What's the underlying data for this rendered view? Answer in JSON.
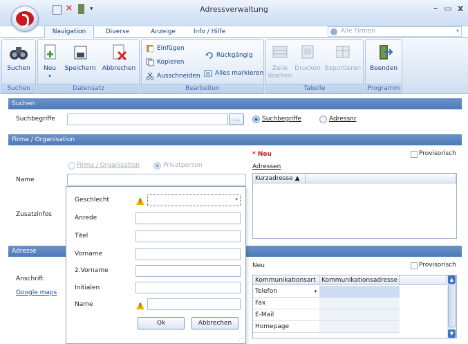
{
  "window": {
    "title": "Adressverwaltung"
  },
  "tabs": [
    "Navigation",
    "Diverse",
    "Anzeige",
    "Info / Hilfe"
  ],
  "company_placeholder": "Alle Firmen",
  "ribbon": {
    "suchen": {
      "button": "Suchen",
      "group": "Suchen"
    },
    "datensatz": {
      "neu": "Neu",
      "speichern": "Speichern",
      "abbrechen": "Abbrechen",
      "group": "Datensatz"
    },
    "bearbeiten": {
      "einfuegen": "Einfügen",
      "kopieren": "Kopieren",
      "ausschneiden": "Ausschneiden",
      "rueckgaengig": "Rückgängig",
      "alles_markieren": "Alles markieren",
      "group": "Bearbeiten"
    },
    "tabelle": {
      "zeile": "Zeile",
      "loeschen": "löschen",
      "drucken": "Drucken",
      "exportieren": "Exportieren",
      "group": "Tabelle"
    },
    "programm": {
      "beenden": "Beenden",
      "group": "Programm"
    }
  },
  "suchen": {
    "header": "Suchen",
    "label": "Suchbegriffe",
    "browse": "....",
    "radio_suchbegriffe": "Suchbegriffe",
    "radio_adressnr": "Adressnr"
  },
  "firma": {
    "header": "Firma / Organisation",
    "radio_firma": "Firma / Organisation",
    "radio_privat": "Privatperson",
    "name_label": "Name",
    "zusatz_label": "Zusatzinfos",
    "neu": "* Neu",
    "adressen": "Adressen",
    "provisorisch": "Provisorisch",
    "grid_col": "Kurzadresse ▲"
  },
  "popup": {
    "geschlecht": "Geschlecht",
    "anrede": "Anrede",
    "titel": "Titel",
    "vorname": "Vorname",
    "vorname2": "2.Vorname",
    "initialen": "Initialen",
    "name": "Name",
    "ok": "Ok",
    "abbrechen": "Abbrechen"
  },
  "adresse": {
    "header": "Adresse",
    "anschrift": "Anschrift",
    "google": "Google maps",
    "neu": "Neu",
    "provisorisch": "Provisorisch",
    "col1": "Kommunikationsart",
    "col2": "Kommunikationsadresse",
    "rows": [
      "Telefon",
      "Fax",
      "E-Mail",
      "Homepage"
    ]
  },
  "colors": {
    "accent": "#15428b",
    "section": "#5a84c0",
    "warning": "#f0b400",
    "danger": "#c81a1e"
  },
  "icons": [
    "binoculars-icon",
    "new-document-icon",
    "save-icon",
    "cancel-icon",
    "paste-icon",
    "copy-icon",
    "cut-icon",
    "undo-icon",
    "select-all-icon",
    "delete-row-icon",
    "print-icon",
    "export-icon",
    "exit-icon",
    "warning-icon"
  ]
}
